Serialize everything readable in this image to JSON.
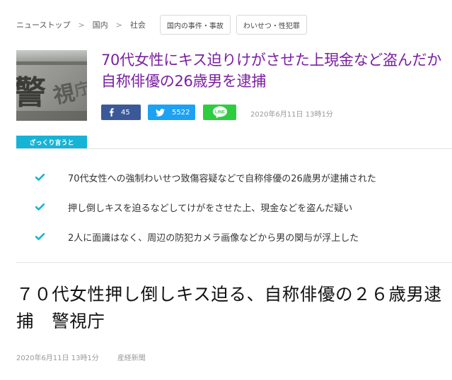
{
  "breadcrumb": {
    "items": [
      "ニューストップ",
      "国内",
      "社会"
    ],
    "separator": ">",
    "tags": [
      "国内の事件・事故",
      "わいせつ・性犯罪"
    ]
  },
  "header": {
    "headline": "70代女性にキス迫りけがさせた上現金など盗んだか 自称俳優の26歳男を逮捕",
    "thumbnail_text": "警視庁",
    "facebook_count": "45",
    "twitter_count": "5522",
    "line_label": "LINE",
    "date": "2020年6月11日 13時1分"
  },
  "summary": {
    "label": "ざっくり言うと",
    "points": [
      "70代女性への強制わいせつ致傷容疑などで自称俳優の26歳男が逮捕された",
      "押し倒しキスを迫るなどしてけがをさせた上、現金などを盗んだ疑い",
      "2人に面識はなく、周辺の防犯カメラ画像などから男の関与が浮上した"
    ]
  },
  "article": {
    "title": "７０代女性押し倒しキス迫る、自称俳優の２６歳男逮捕　警視庁",
    "date": "2020年6月11日 13時1分",
    "source": "産経新聞"
  },
  "colors": {
    "headline": "#7b1fa2",
    "facebook": "#3b5998",
    "twitter": "#1da1f2",
    "line": "#2ecc40",
    "accent": "#17b3d6"
  },
  "icons": [
    "facebook-icon",
    "twitter-icon",
    "line-icon",
    "check-icon"
  ]
}
